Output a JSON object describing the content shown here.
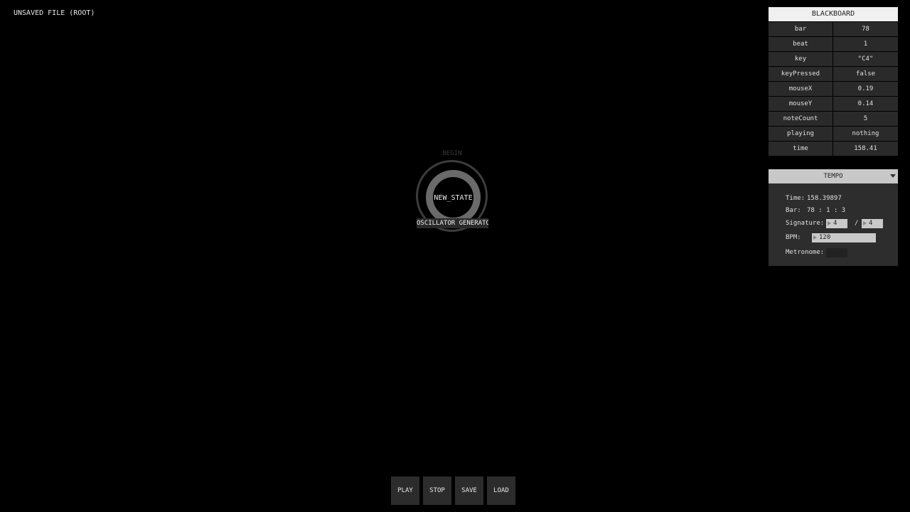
{
  "file": {
    "title": "UNSAVED FILE (ROOT)"
  },
  "state_node": {
    "begin_label": "BEGIN",
    "name": "NEW_STATE",
    "generator": "OSCILLATOR GENERATOR"
  },
  "blackboard": {
    "title": "BLACKBOARD",
    "rows": [
      {
        "key": "bar",
        "value": "78"
      },
      {
        "key": "beat",
        "value": "1"
      },
      {
        "key": "key",
        "value": "\"C4\""
      },
      {
        "key": "keyPressed",
        "value": "false"
      },
      {
        "key": "mouseX",
        "value": "0.19"
      },
      {
        "key": "mouseY",
        "value": "0.14"
      },
      {
        "key": "noteCount",
        "value": "5"
      },
      {
        "key": "playing",
        "value": "nothing"
      },
      {
        "key": "time",
        "value": "158.41"
      }
    ]
  },
  "tempo": {
    "title": "TEMPO",
    "time_label": "Time:",
    "time_value": "158.39897",
    "bar_label": "Bar:",
    "bar_value": "78 : 1 : 3",
    "signature_label": "Signature:",
    "signature_numerator": "4",
    "signature_separator": "/",
    "signature_denominator": "4",
    "bpm_label": "BPM:",
    "bpm_value": "120",
    "metronome_label": "Metronome:"
  },
  "controls": {
    "play": "PLAY",
    "stop": "STOP",
    "save": "SAVE",
    "load": "LOAD"
  }
}
